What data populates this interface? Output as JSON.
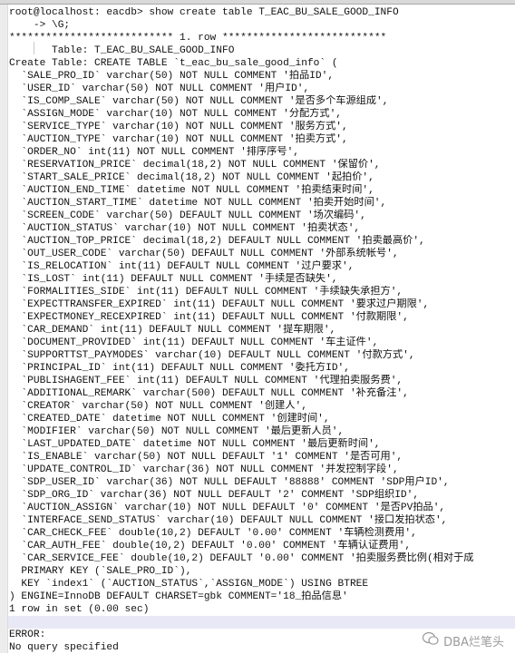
{
  "terminal": {
    "highlight_line_index": 48,
    "lines": [
      "root@localhost: eacdb> show create table T_EAC_BU_SALE_GOOD_INFO",
      "    -> \\G;",
      "*************************** 1. row ***************************",
      "       Table: T_EAC_BU_SALE_GOOD_INFO",
      "Create Table: CREATE TABLE `t_eac_bu_sale_good_info` (",
      "  `SALE_PRO_ID` varchar(50) NOT NULL COMMENT '拍品ID',",
      "  `USER_ID` varchar(50) NOT NULL COMMENT '用户ID',",
      "  `IS_COMP_SALE` varchar(50) NOT NULL COMMENT '是否多个车源组成',",
      "  `ASSIGN_MODE` varchar(10) NOT NULL COMMENT '分配方式',",
      "  `SERVICE_TYPE` varchar(10) NOT NULL COMMENT '服务方式',",
      "  `AUCTION_TYPE` varchar(10) NOT NULL COMMENT '拍卖方式',",
      "  `ORDER_NO` int(11) NOT NULL COMMENT '排序序号',",
      "  `RESERVATION_PRICE` decimal(18,2) NOT NULL COMMENT '保留价',",
      "  `START_SALE_PRICE` decimal(18,2) NOT NULL COMMENT '起拍价',",
      "  `AUCTION_END_TIME` datetime NOT NULL COMMENT '拍卖结束时间',",
      "  `AUCTION_START_TIME` datetime NOT NULL COMMENT '拍卖开始时间',",
      "  `SCREEN_CODE` varchar(50) DEFAULT NULL COMMENT '场次编码',",
      "  `AUCTION_STATUS` varchar(10) NOT NULL COMMENT '拍卖状态',",
      "  `AUCTION_TOP_PRICE` decimal(18,2) DEFAULT NULL COMMENT '拍卖最高价',",
      "  `OUT_USER_CODE` varchar(50) DEFAULT NULL COMMENT '外部系统帐号',",
      "  `IS_RELOCATION` int(11) DEFAULT NULL COMMENT '过户要求',",
      "  `IS_LOST` int(11) DEFAULT NULL COMMENT '手续是否缺失',",
      "  `FORMALITIES_SIDE` int(11) DEFAULT NULL COMMENT '手续缺失承担方',",
      "  `EXPECTTRANSFER_EXPIRED` int(11) DEFAULT NULL COMMENT '要求过户期限',",
      "  `EXPECTMONEY_RECEXPIRED` int(11) DEFAULT NULL COMMENT '付款期限',",
      "  `CAR_DEMAND` int(11) DEFAULT NULL COMMENT '提车期限',",
      "  `DOCUMENT_PROVIDED` int(11) DEFAULT NULL COMMENT '车主证件',",
      "  `SUPPORTTST_PAYMODES` varchar(10) DEFAULT NULL COMMENT '付款方式',",
      "  `PRINCIPAL_ID` int(11) DEFAULT NULL COMMENT '委托方ID',",
      "  `PUBLISHAGENT_FEE` int(11) DEFAULT NULL COMMENT '代理拍卖服务费',",
      "  `ADDITIONAL_REMARK` varchar(500) DEFAULT NULL COMMENT '补充备注',",
      "  `CREATOR` varchar(50) NOT NULL COMMENT '创建人',",
      "  `CREATED_DATE` datetime NOT NULL COMMENT '创建时间',",
      "  `MODIFIER` varchar(50) NOT NULL COMMENT '最后更新人员',",
      "  `LAST_UPDATED_DATE` datetime NOT NULL COMMENT '最后更新时间',",
      "  `IS_ENABLE` varchar(50) NOT NULL DEFAULT '1' COMMENT '是否可用',",
      "  `UPDATE_CONTROL_ID` varchar(36) NOT NULL COMMENT '并发控制字段',",
      "  `SDP_USER_ID` varchar(36) NOT NULL DEFAULT '88888' COMMENT 'SDP用户ID',",
      "  `SDP_ORG_ID` varchar(36) NOT NULL DEFAULT '2' COMMENT 'SDP组织ID',",
      "  `AUCTION_ASSIGN` varchar(10) NOT NULL DEFAULT '0' COMMENT '是否PV拍品',",
      "  `INTERFACE_SEND_STATUS` varchar(10) DEFAULT NULL COMMENT '接口发拍状态',",
      "  `CAR_CHECK_FEE` double(10,2) DEFAULT '0.00' COMMENT '车辆检测费用',",
      "  `CAR_AUTH_FEE` double(10,2) DEFAULT '0.00' COMMENT '车辆认证费用',",
      "  `CAR_SERVICE_FEE` double(10,2) DEFAULT '0.00' COMMENT '拍卖服务费比例(相对于成",
      "  PRIMARY KEY (`SALE_PRO_ID`),",
      "  KEY `index1` (`AUCTION_STATUS`,`ASSIGN_MODE`) USING BTREE",
      ") ENGINE=InnoDB DEFAULT CHARSET=gbk COMMENT='18_拍品信息'",
      "1 row in set (0.00 sec)",
      "",
      "ERROR:",
      "No query specified"
    ]
  },
  "watermark": {
    "text": "DBA烂笔头",
    "icon": "wechat-icon"
  }
}
